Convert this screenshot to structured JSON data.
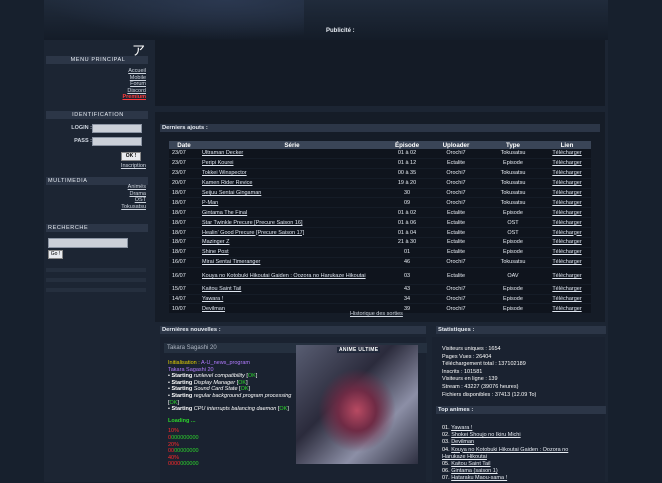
{
  "header": {
    "pub_label": "Publicité :"
  },
  "sidebar": {
    "logo_glyph": "ア",
    "menu_title": "Menu principal",
    "menu_links": [
      "Accueil",
      "Mobile",
      "Forum",
      "Discord",
      "Premium"
    ],
    "ident_title": "Identification",
    "login_label": "LOGIN :",
    "pass_label": "PASS :",
    "ok_label": "OK !",
    "inscription_label": "Inscription",
    "multimedia_title": "Multimedia",
    "multimedia_links": [
      "Animés",
      "Drama",
      "OST",
      "Tokusatsu"
    ],
    "search_title": "Recherche",
    "go_label": "Go !"
  },
  "downloads": {
    "title": "Derniers ajouts :",
    "columns": [
      "Date",
      "Série",
      "Épisode",
      "Uploader",
      "Type",
      "Lien"
    ],
    "rows": [
      [
        "23/07",
        "Ultraman Decker",
        "01 à 02",
        "Orochi7",
        "Tokusatsu",
        "Télécharger"
      ],
      [
        "23/07",
        "Peripi Kourei",
        "01 à 12",
        "Ectalite",
        "Episode",
        "Télécharger"
      ],
      [
        "23/07",
        "Tokkei Winspector",
        "00 à 35",
        "Orochi7",
        "Tokusatsu",
        "Télécharger"
      ],
      [
        "20/07",
        "Kamen Rider Revice",
        "19 à 20",
        "Orochi7",
        "Tokusatsu",
        "Télécharger"
      ],
      [
        "18/07",
        "Seijuu Sentai Gingaman",
        "30",
        "Orochi7",
        "Tokusatsu",
        "Télécharger"
      ],
      [
        "18/07",
        "P-Man",
        "09",
        "Orochi7",
        "Tokusatsu",
        "Télécharger"
      ],
      [
        "18/07",
        "Gintama The Final",
        "01 à 02",
        "Ectalite",
        "Episode",
        "Télécharger"
      ],
      [
        "18/07",
        "Star Twinkle Precure [Precure Saison 16]",
        "01 à 06",
        "Ectalite",
        "OST",
        "Télécharger"
      ],
      [
        "18/07",
        "Healin' Good Precure [Precure Saison 17]",
        "01 à 04",
        "Ectalite",
        "OST",
        "Télécharger"
      ],
      [
        "18/07",
        "Mazinger Z",
        "21 à 30",
        "Ectalite",
        "Episode",
        "Télécharger"
      ],
      [
        "18/07",
        "Shine Post",
        "01",
        "Ectalite",
        "Episode",
        "Télécharger"
      ],
      [
        "16/07",
        "Mirai Sentai Timeranger",
        "46",
        "Orochi7",
        "Tokusatsu",
        "Télécharger"
      ],
      [
        "16/07",
        "Kouya no Kotobuki Hikoutai Gaiden : Oozora no Harukaze Hikoutai",
        "03",
        "Ectalite",
        "OAV",
        "Télécharger"
      ],
      [
        "15/07",
        "Kaitou Saint Tail",
        "43",
        "Orochi7",
        "Episode",
        "Télécharger"
      ],
      [
        "14/07",
        "Yawara !",
        "34",
        "Orochi7",
        "Episode",
        "Télécharger"
      ],
      [
        "10/07",
        "Devilman",
        "39",
        "Orochi7",
        "Episode",
        "Télécharger"
      ]
    ],
    "history_label": "Historique des sorties"
  },
  "news": {
    "title": "Dernières nouvelles :",
    "author": "Takara Sagashi 20",
    "image_label": "ANIME ULTIME",
    "init_label": "Initialisation",
    "init_sep": ":",
    "init_target": "A-U_news_program",
    "init_sub": "Takara Sagashi 20",
    "boot_lines": [
      {
        "verb": "Starting",
        "item": "runlevel compatibility",
        "status": "OK"
      },
      {
        "verb": "Starting",
        "item": "Display Manager",
        "status": "OK"
      },
      {
        "verb": "Starting",
        "item": "Sound Card State",
        "status": "OK"
      },
      {
        "verb": "Starting",
        "item": "regular background program processing",
        "status": "OK"
      },
      {
        "verb": "Starting",
        "item": "CPU interrupts balancing daemon",
        "status": "OK"
      }
    ],
    "loading_label": "Loading ...",
    "progress": [
      {
        "pct": "10%",
        "bar": "0000000000",
        "filled": 1
      },
      {
        "pct": "20%",
        "bar": "0000000000",
        "filled": 2
      },
      {
        "pct": "40%",
        "bar": "0000000000",
        "filled": 4
      }
    ]
  },
  "stats": {
    "title": "Statistiques :",
    "lines": [
      "Visiteurs uniques : 1654",
      "Pages Vues : 26404",
      "Téléchargement total : 137102189",
      "Inscrits : 101581",
      "Visiteurs en ligne : 139",
      "Stream : 43227 (39076 heures)",
      "Fichiers disponibles : 37413 (12.09 To)"
    ]
  },
  "top": {
    "title": "Top animes :",
    "items": [
      {
        "num": "01.",
        "name": "Yawara !"
      },
      {
        "num": "02.",
        "name": "Shokei Shoujo no Ikiru Michi"
      },
      {
        "num": "03.",
        "name": "Devilman"
      },
      {
        "num": "04.",
        "name": "Kouya no Kotobuki Hikoutai Gaiden : Oozora no Harukaze Hikoutai"
      },
      {
        "num": "05.",
        "name": "Kaitou Saint Tail"
      },
      {
        "num": "06.",
        "name": "Gintama (saison 1)"
      },
      {
        "num": "07.",
        "name": "Hataraku Maou-sama !"
      }
    ]
  },
  "colors": {
    "promo": "#ff3b3b",
    "ok": "#2cd42c",
    "progress": "#ff2a2a",
    "accent_bg": "#2c3647"
  }
}
